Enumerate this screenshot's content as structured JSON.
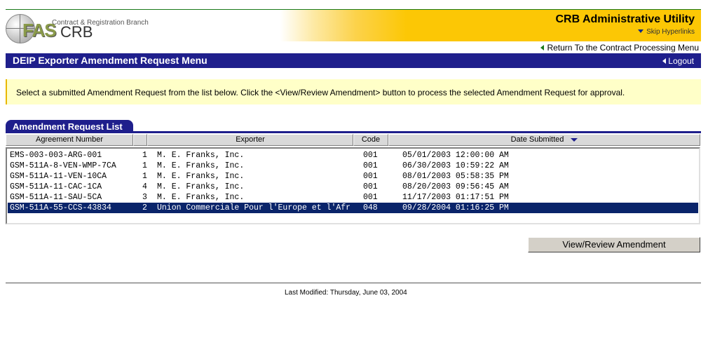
{
  "header": {
    "logo_sub": "Contract & Registration Branch",
    "logo_fas": "FAS",
    "logo_crb": "CRB",
    "app_title": "CRB Administrative Utility",
    "skip_link": "Skip Hyperlinks",
    "return_link": "Return To the Contract Processing Menu"
  },
  "menu_bar": {
    "title": "DEIP Exporter Amendment Request Menu",
    "logout": "Logout"
  },
  "instruction": "Select a submitted Amendment Request from the list below.  Click the <View/Review Amendment> button to process the selected Amendment Request for approval.",
  "list": {
    "tab_label": "Amendment Request List",
    "columns": {
      "agreement": "Agreement Number",
      "num": "",
      "exporter": "Exporter",
      "code": "Code",
      "date": "Date Submitted"
    },
    "rows": [
      {
        "agreement": "EMS-003-003-ARG-001",
        "num": "1",
        "exporter": "M. E. Franks, Inc.",
        "code": "001",
        "date": "05/01/2003 12:00:00 AM"
      },
      {
        "agreement": "GSM-511A-8-VEN-WMP-7CA",
        "num": "1",
        "exporter": "M. E. Franks, Inc.",
        "code": "001",
        "date": "06/30/2003 10:59:22 AM"
      },
      {
        "agreement": "GSM-511A-11-VEN-10CA",
        "num": "1",
        "exporter": "M. E. Franks, Inc.",
        "code": "001",
        "date": "08/01/2003 05:58:35 PM"
      },
      {
        "agreement": "GSM-511A-11-CAC-1CA",
        "num": "4",
        "exporter": "M. E. Franks, Inc.",
        "code": "001",
        "date": "08/20/2003 09:56:45 AM"
      },
      {
        "agreement": "GSM-511A-11-SAU-5CA",
        "num": "3",
        "exporter": "M. E. Franks, Inc.",
        "code": "001",
        "date": "11/17/2003 01:17:51 PM"
      },
      {
        "agreement": "GSM-511A-55-CCS-43834",
        "num": "2",
        "exporter": "Union Commerciale Pour l'Europe et l'Afr",
        "code": "048",
        "date": "09/28/2004 01:16:25 PM"
      }
    ],
    "selected_index": 5
  },
  "button": {
    "view_review_label": "View/Review Amendment"
  },
  "footer": {
    "last_modified": "Last Modified:  Thursday, June 03, 2004"
  },
  "colors": {
    "nav_blue": "#1f1f8c",
    "selection": "#0a246a",
    "banner_yellow": "#fcc705",
    "instruction_bg": "#ffffc8"
  }
}
